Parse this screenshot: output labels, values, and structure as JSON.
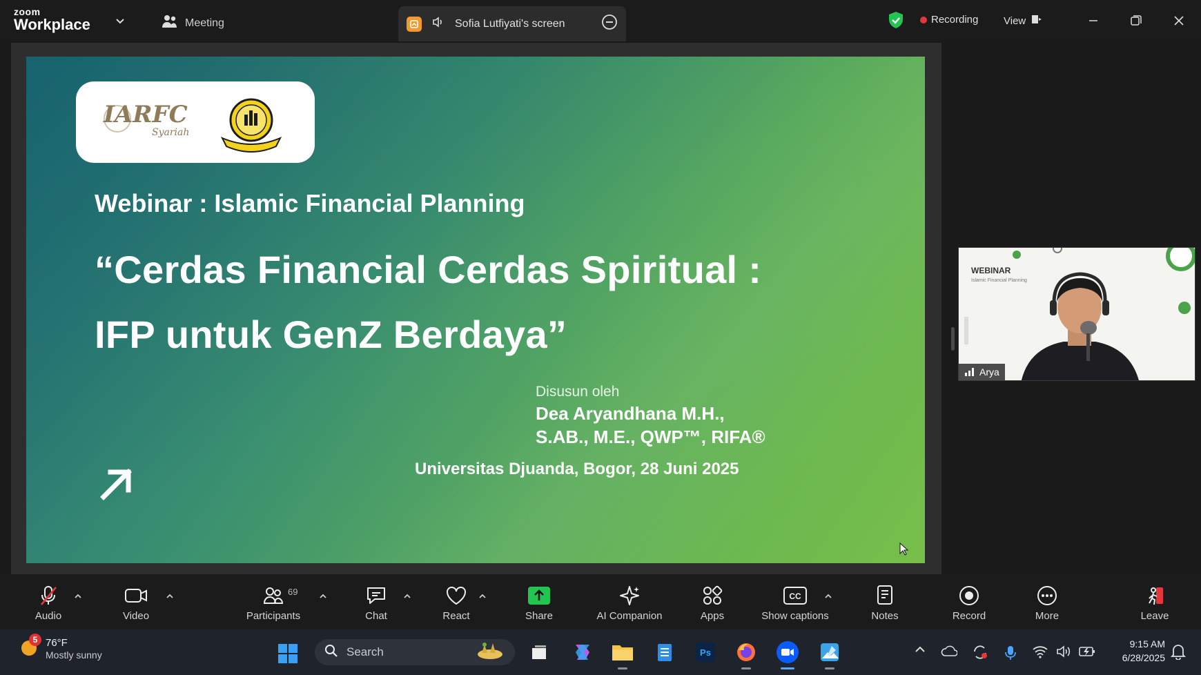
{
  "app": {
    "brand_small": "zoom",
    "brand_large": "Workplace",
    "meeting_label": "Meeting"
  },
  "share_tab": {
    "title": "Sofia Lutfiyati's screen"
  },
  "status": {
    "recording": "Recording",
    "view": "View"
  },
  "slide": {
    "webinar": "Webinar : Islamic Financial Planning",
    "title_line1": "“Cerdas Financial Cerdas Spiritual :",
    "title_line2": "IFP untuk GenZ Berdaya”",
    "by": "Disusun oleh",
    "author_line1": "Dea Aryandhana M.H.,",
    "author_line2": "S.AB., M.E., QWP™, RIFA®",
    "venue": "Universitas Djuanda, Bogor, 28 Juni 2025",
    "logo_text": "IARFC",
    "logo_sub": "Syariah"
  },
  "participant_video": {
    "name": "Arya",
    "slide_label": "WEBINAR",
    "slide_sub": "Islamic Financial Planning"
  },
  "toolbar": {
    "audio": "Audio",
    "video": "Video",
    "participants": "Participants",
    "participants_count": "69",
    "chat": "Chat",
    "react": "React",
    "share": "Share",
    "ai_companion": "AI Companion",
    "apps": "Apps",
    "captions": "Show captions",
    "notes": "Notes",
    "record": "Record",
    "more": "More",
    "leave": "Leave"
  },
  "taskbar": {
    "temp": "76°F",
    "weather": "Mostly sunny",
    "weather_badge": "5",
    "search_placeholder": "Search",
    "time": "9:15 AM",
    "date": "6/28/2025"
  },
  "colors": {
    "accent_green": "#23c552",
    "record_red": "#e5373b",
    "slide_teal": "#1e6f78",
    "slide_green": "#78bf4a"
  }
}
